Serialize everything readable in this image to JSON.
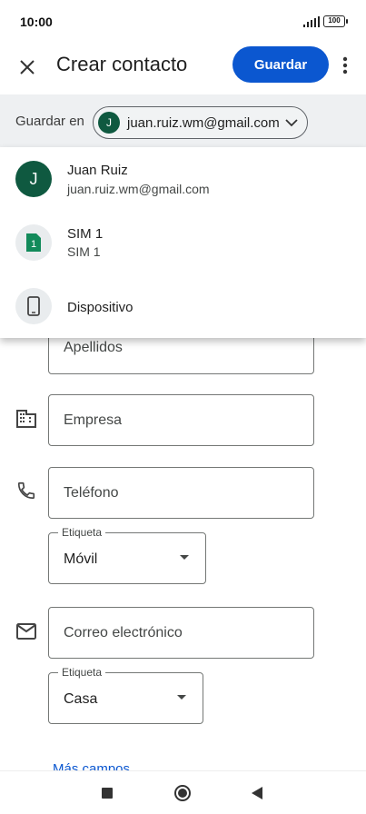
{
  "status_bar": {
    "time": "10:00",
    "battery": "100"
  },
  "app_bar": {
    "title": "Crear contacto",
    "save_label": "Guardar"
  },
  "save_in": {
    "label": "Guardar en",
    "avatar_initial": "J",
    "email": "juan.ruiz.wm@gmail.com"
  },
  "dropdown": {
    "items": [
      {
        "title": "Juan Ruiz",
        "subtitle": "juan.ruiz.wm@gmail.com",
        "avatar": "J",
        "icon": "account-avatar"
      },
      {
        "title": "SIM 1",
        "subtitle": "SIM 1",
        "avatar": "1",
        "icon": "sim-card-icon"
      },
      {
        "title": "Dispositivo",
        "subtitle": "",
        "icon": "phone-device-icon"
      }
    ]
  },
  "form": {
    "last_name_placeholder": "Apellidos",
    "company_placeholder": "Empresa",
    "phone_placeholder": "Teléfono",
    "phone_label_caption": "Etiqueta",
    "phone_label_value": "Móvil",
    "email_placeholder": "Correo electrónico",
    "email_label_caption": "Etiqueta",
    "email_label_value": "Casa",
    "more_fields": "Más campos"
  },
  "colors": {
    "primary": "#0b57d0",
    "avatar_green": "#0f5940",
    "sim_green": "#128a5a"
  }
}
